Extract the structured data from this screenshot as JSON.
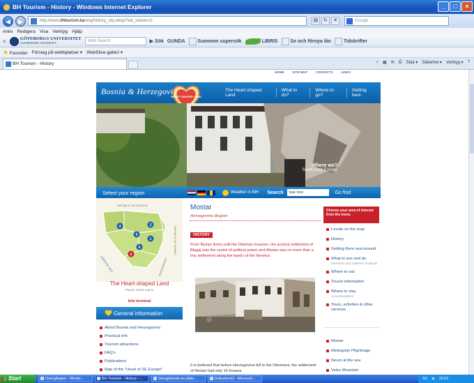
{
  "window": {
    "title": "BH Tourism - History - Windows Internet Explorer"
  },
  "address_bar": {
    "url_prefix": "http://www.",
    "url_domain": "bhtourism.ba",
    "url_rest": "/eng/history_city.wbsp?sid_station=2;",
    "search_placeholder": "Google"
  },
  "menu": [
    "Arkiv",
    "Redigera",
    "Visa",
    "Verktyg",
    "Hjälp"
  ],
  "toolbar": {
    "university_name": "GÖTEBORGS UNIVERSITET",
    "university_sub": "GOTHENBURG UNIVERSITY",
    "web_search_placeholder": "Web Search",
    "sok_label": "Sök",
    "gunda": "GUNDA",
    "summon": "Summon supersök",
    "libris": "LIBRIS",
    "se_och_fornya": "Se och förnya lån",
    "tidskrifter": "Tidskrifter"
  },
  "favorites_bar": {
    "favorites": "Favoriter",
    "suggested": "Förslag på webbplatser ▾",
    "webslice": "WebSlice-galleri ▾"
  },
  "tab": {
    "label": "BH Tourism - History"
  },
  "command_bar": [
    "Sida ▾",
    "Säkerhet ▾",
    "Verktyg ▾"
  ],
  "site": {
    "top_links": [
      "HOME",
      "SITE MAP",
      "CONTACTS",
      "LINKS"
    ],
    "logo_text": "Bosnia & Herzegovina",
    "heart_logo_text": "HEART SHAPED LAND",
    "nav": [
      "The Heart-shaped Land",
      "What to do?",
      "Where to go?",
      "Getting here"
    ],
    "hero_text_1": "Where we?",
    "hero_text_2": "South East Europe",
    "region_bar": {
      "select_region": "Select your region",
      "weather": "Weather in BiH",
      "search_label": "Search",
      "search_placeholder": "type here",
      "go_find": "Go find"
    },
    "map": {
      "label_north": "REPUBLIC OF CROATIA",
      "label_east": "REPUBLIC OF SERBIA",
      "label_south_east": "MONTENEGRO",
      "label_sea": "ADRIATIC SEA",
      "region_numbers": [
        "4",
        "3",
        "5",
        "1",
        "6",
        "2"
      ]
    },
    "heartland_title": "The Heart-shaped Land",
    "please_select": "Please select region",
    "info_terminal": "Info terminal",
    "general_info": "General information",
    "left_links": [
      "About Bosnia and Herzegovina",
      "Practical info",
      "Tourism attractions",
      "FAQ's",
      "Publications",
      "Map of the \"Heart of SE Europe\""
    ],
    "city_title": "Mostar",
    "region_subtitle": "Herzegovina Region",
    "history_tag": "HISTORY",
    "intro": "From Illyrian times until the Ottoman invasion, the ancient settlement of Blagaj was the centre of political power and Mostar was no more than a tiny settlement along the banks of the Neretva.",
    "body": "It is believed that before Herzegovina fell to the Ottomans, the settlement of Mostar had only 19 houses",
    "choose_area": "Choose your area of interest from the menu",
    "right_links_1": [
      {
        "label": "Locate on the map",
        "sub": ""
      },
      {
        "label": "History",
        "sub": ""
      },
      {
        "label": "Getting there and around",
        "sub": ""
      },
      {
        "label": "What to see and do",
        "sub": "Museums and Galleries Festivals"
      },
      {
        "label": "Where to eat",
        "sub": ""
      },
      {
        "label": "Tourist information",
        "sub": ""
      },
      {
        "label": "Where to stay",
        "sub": "Accommodation"
      },
      {
        "label": "Tours, activities & other services",
        "sub": ""
      }
    ],
    "right_links_2": [
      "Mostar",
      "Medugorje Pilgrimage",
      "Neum at the sea",
      "Velez Mountain"
    ]
  },
  "taskbar": {
    "start": "Start",
    "tasks": [
      "Overgången - Windo...",
      "BH Tourism - History -...",
      "Varuglirande av plats...",
      "Dokument2 - Microsof..."
    ],
    "tray_lang": "SV",
    "clock": "15:52"
  }
}
